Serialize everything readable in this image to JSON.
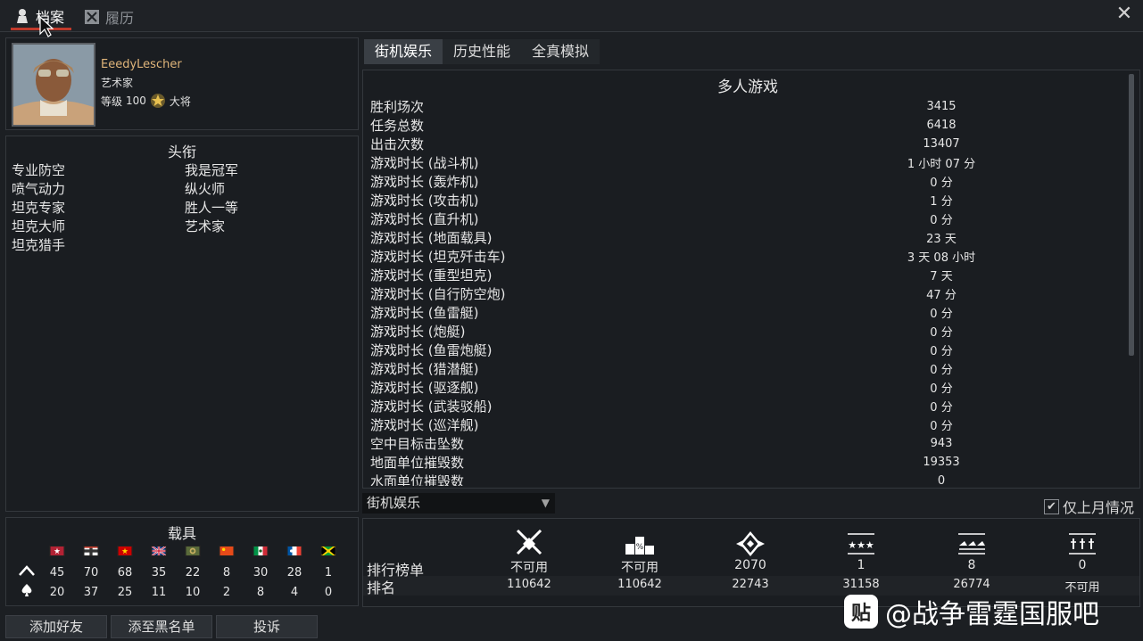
{
  "top_tabs": {
    "profile": "档案",
    "history": "履历"
  },
  "profile": {
    "username": "EeedyLescher",
    "title": "艺术家",
    "level_label": "等级",
    "level": "100",
    "rank": "大将"
  },
  "titles": {
    "heading": "头衔",
    "items": [
      "专业防空",
      "我是冠军",
      "喷气动力",
      "纵火师",
      "坦克专家",
      "胜人一等",
      "坦克大师",
      "艺术家",
      "坦克猎手"
    ]
  },
  "vehicles": {
    "heading": "载具",
    "air": [
      "45",
      "70",
      "68",
      "35",
      "22",
      "8",
      "30",
      "28",
      "1"
    ],
    "ground": [
      "20",
      "37",
      "25",
      "11",
      "10",
      "2",
      "8",
      "4",
      "0"
    ]
  },
  "buttons": {
    "add_friend": "添加好友",
    "blacklist": "添至黑名单",
    "report": "投诉"
  },
  "stat_tabs": [
    "街机娱乐",
    "历史性能",
    "全真模拟"
  ],
  "stats": {
    "heading": "多人游戏",
    "rows": [
      {
        "label": "胜利场次",
        "value": "3415"
      },
      {
        "label": "任务总数",
        "value": "6418"
      },
      {
        "label": "出击次数",
        "value": "13407"
      },
      {
        "label": "游戏时长 (战斗机)",
        "value": "1 小时 07 分"
      },
      {
        "label": "游戏时长 (轰炸机)",
        "value": "0 分"
      },
      {
        "label": "游戏时长 (攻击机)",
        "value": "1 分"
      },
      {
        "label": "游戏时长 (直升机)",
        "value": "0 分"
      },
      {
        "label": "游戏时长 (地面载具)",
        "value": "23 天"
      },
      {
        "label": "游戏时长 (坦克歼击车)",
        "value": "3 天 08 小时"
      },
      {
        "label": "游戏时长 (重型坦克)",
        "value": "7 天"
      },
      {
        "label": "游戏时长 (自行防空炮)",
        "value": "47 分"
      },
      {
        "label": "游戏时长 (鱼雷艇)",
        "value": "0 分"
      },
      {
        "label": "游戏时长 (炮艇)",
        "value": "0 分"
      },
      {
        "label": "游戏时长 (鱼雷炮艇)",
        "value": "0 分"
      },
      {
        "label": "游戏时长 (猎潜艇)",
        "value": "0 分"
      },
      {
        "label": "游戏时长 (驱逐舰)",
        "value": "0 分"
      },
      {
        "label": "游戏时长 (武装驳船)",
        "value": "0 分"
      },
      {
        "label": "游戏时长 (巡洋舰)",
        "value": "0 分"
      },
      {
        "label": "空中目标击坠数",
        "value": "943"
      },
      {
        "label": "地面单位摧毁数",
        "value": "19353"
      },
      {
        "label": "水面单位摧毁数",
        "value": "0"
      }
    ]
  },
  "mode_select": {
    "value": "街机娱乐"
  },
  "last_month": {
    "label": "仅上月情况",
    "checked": true
  },
  "leaderboard": {
    "row1_label": "排行榜单",
    "row2_label": "排名",
    "columns": [
      {
        "icon": "crossed-swords-icon",
        "value": "不可用",
        "rank": "110642"
      },
      {
        "icon": "percent-podium-icon",
        "value": "不可用",
        "rank": "110642"
      },
      {
        "icon": "diamond-wings-icon",
        "value": "2070",
        "rank": "22743"
      },
      {
        "icon": "three-stars-icon",
        "value": "1",
        "rank": "31158"
      },
      {
        "icon": "aircraft-row-icon",
        "value": "8",
        "rank": "26774"
      },
      {
        "icon": "tanks-row-icon",
        "value": "0",
        "rank": "不可用"
      }
    ]
  },
  "watermark": {
    "logo": "贴",
    "text": "@战争雷霆国服吧"
  }
}
